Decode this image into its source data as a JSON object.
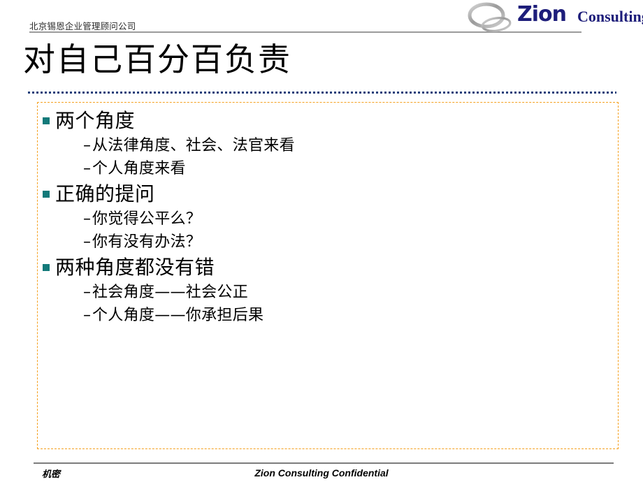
{
  "header": {
    "company_cn": "北京锡恩企业管理顾问公司"
  },
  "logo": {
    "word": "Zion",
    "sub": "Consulting",
    "ring_icon": "ring-ellipse-icon",
    "color": "#1d1d7a"
  },
  "title": "对自己百分百负责",
  "colors": {
    "bullet_teal": "#137a7a",
    "box_border_orange": "#f5a01e",
    "divider_blue": "#243f7a",
    "rule_gray": "#9b9b9b",
    "logo_navy": "#1d1d7a"
  },
  "content": {
    "groups": [
      {
        "heading": "两个角度",
        "items": [
          "从法律角度、社会、法官来看",
          "个人角度来看"
        ]
      },
      {
        "heading": "正确的提问",
        "items": [
          "你觉得公平么？",
          "你有没有办法？"
        ]
      },
      {
        "heading": "两种角度都没有错",
        "items": [
          "社会角度——社会公正",
          "个人角度——你承担后果"
        ]
      }
    ],
    "dash_marker": "–"
  },
  "footer": {
    "left": "机密",
    "center": "Zion Consulting Confidential"
  }
}
